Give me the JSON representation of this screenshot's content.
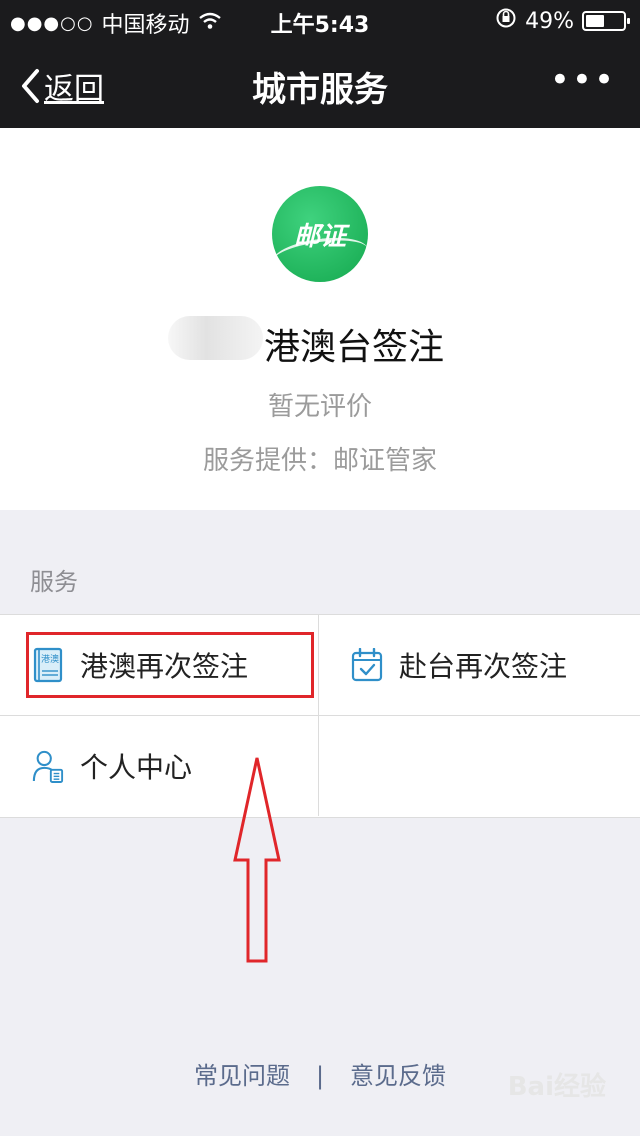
{
  "status_bar": {
    "signal": "●●●○○",
    "carrier": "中国移动",
    "time": "上午5:43",
    "battery": "49%",
    "battery_level": 0.49
  },
  "nav": {
    "back_label": "返回",
    "title": "城市服务",
    "more": "•••"
  },
  "profile": {
    "logo_text": "邮证",
    "name": "港澳台签注",
    "rating": "暂无评价",
    "provider": "服务提供：邮证管家"
  },
  "services": {
    "section_label": "服务",
    "items": [
      {
        "label": "港澳再次签注",
        "icon": "hk-macau-permit-icon",
        "icon_text": "港澳"
      },
      {
        "label": "赴台再次签注",
        "icon": "calendar-check-icon"
      },
      {
        "label": "个人中心",
        "icon": "user-profile-icon"
      }
    ]
  },
  "footer": {
    "faq": "常见问题",
    "separator": "|",
    "feedback": "意见反馈"
  },
  "watermark": "Bai经验",
  "colors": {
    "navbar": "#1b1b1d",
    "logo_green": "#1fb85a",
    "highlight_red": "#e0262a",
    "icon_blue": "#2f8fc9",
    "link_blue": "#5b6b8c"
  }
}
